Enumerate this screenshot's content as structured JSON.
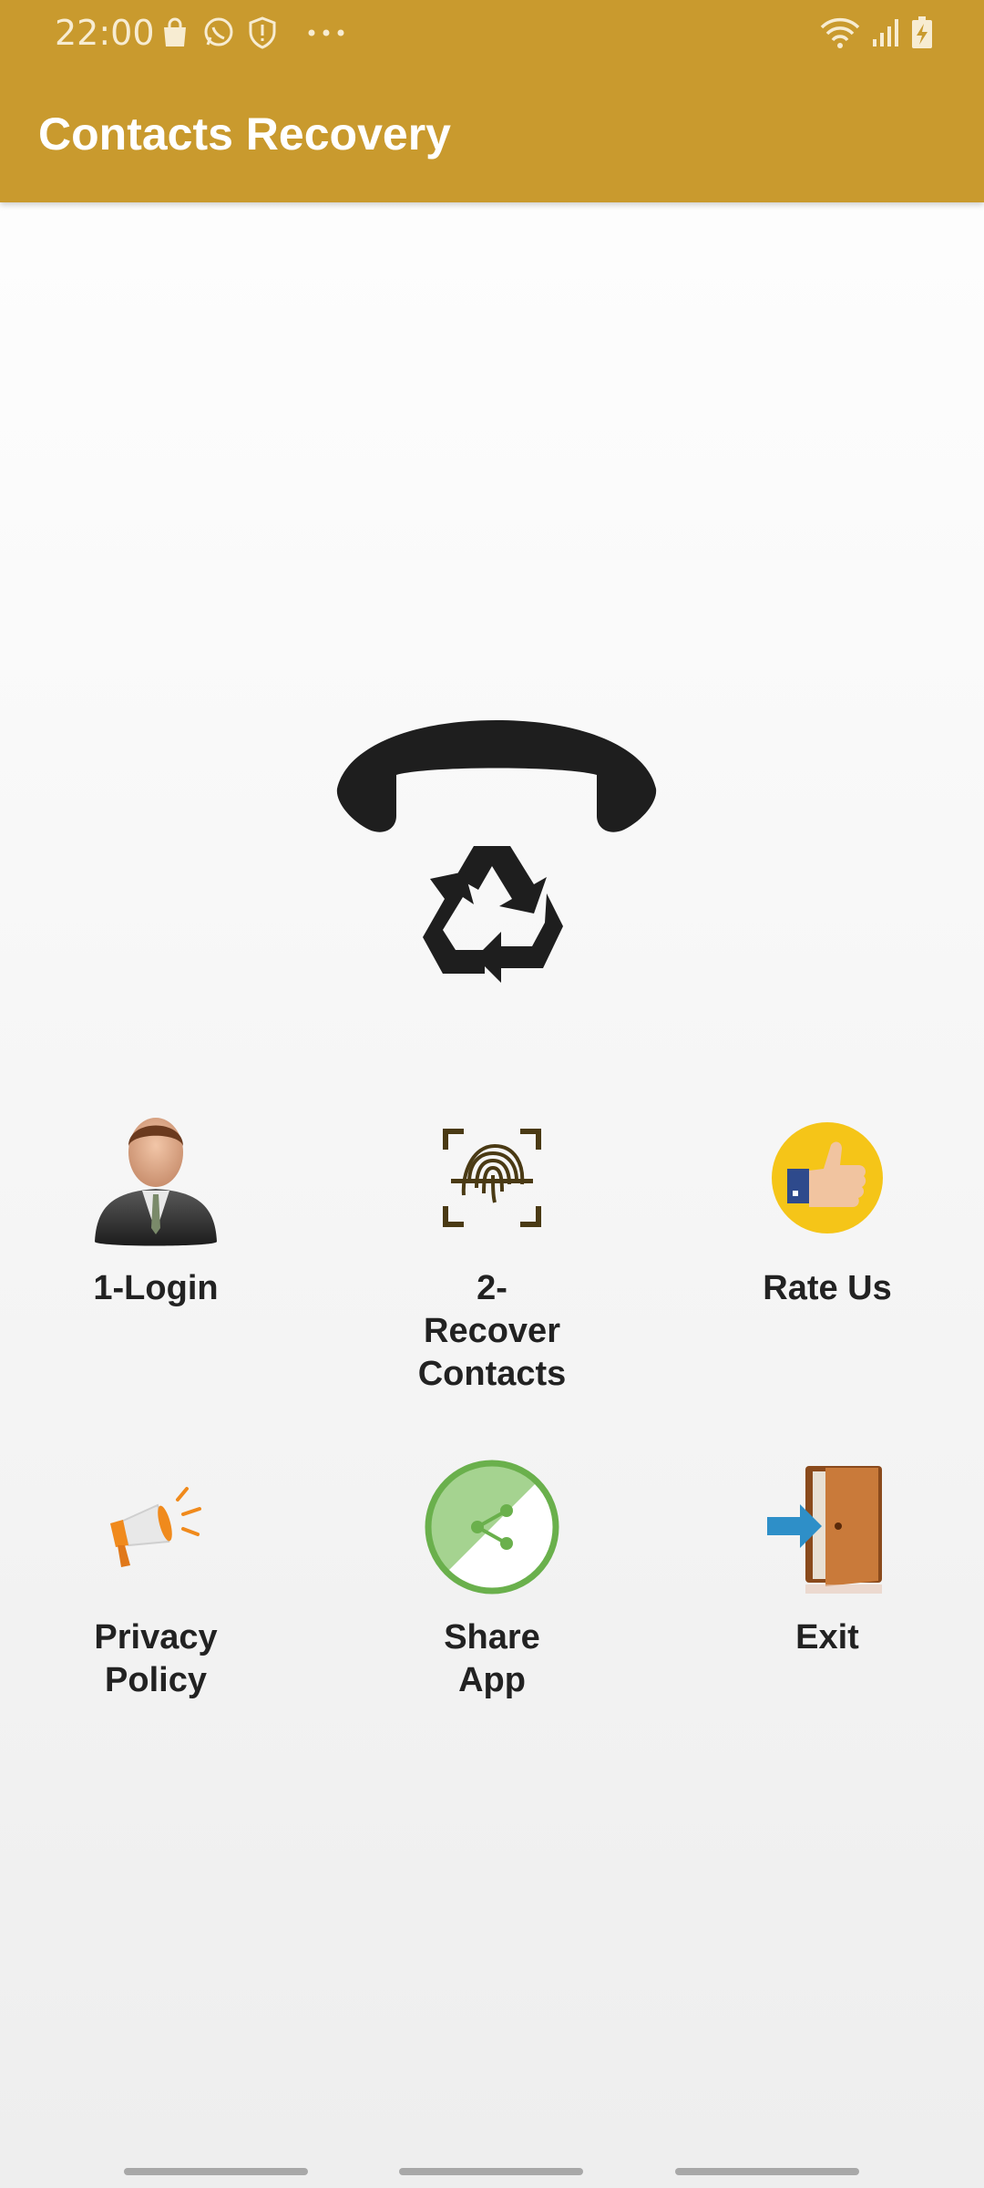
{
  "status_bar": {
    "time": "22:00",
    "left_icons": [
      "shopping-bag-icon",
      "whatsapp-icon",
      "shield-icon",
      "more-dots-icon"
    ],
    "right_icons": [
      "wifi-icon",
      "signal-icon",
      "battery-charging-icon"
    ]
  },
  "app_bar": {
    "title": "Contacts Recovery",
    "color": "#c99a2e"
  },
  "hero": {
    "icon": "phone-recycle-icon"
  },
  "menu": {
    "items": [
      {
        "label": "1-Login",
        "icon": "businessman-icon"
      },
      {
        "label": "2-\nRecover\nContacts",
        "icon": "fingerprint-icon"
      },
      {
        "label": "Rate Us",
        "icon": "thumbs-up-icon"
      },
      {
        "label": "Privacy\nPolicy",
        "icon": "megaphone-icon"
      },
      {
        "label": "Share\nApp",
        "icon": "share-icon"
      },
      {
        "label": "Exit",
        "icon": "exit-door-icon"
      }
    ]
  },
  "colors": {
    "accent": "#c99a2e",
    "share_green": "#6ab04c",
    "rate_yellow": "#f5c518",
    "text": "#222222"
  }
}
